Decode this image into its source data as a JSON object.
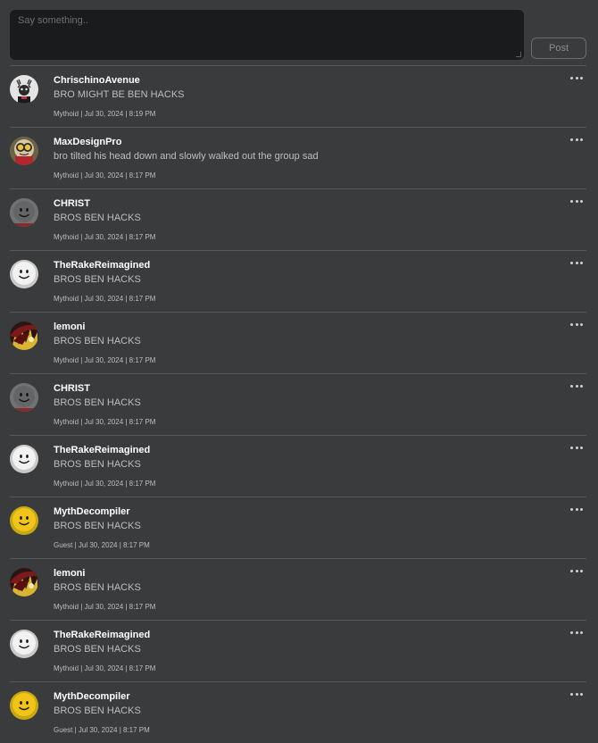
{
  "composer": {
    "placeholder": "Say something..",
    "post_label": "Post"
  },
  "comments": [
    {
      "author": "ChrischinoAvenue",
      "text": "BRO MIGHT BE BEN HACKS",
      "role": "Mythoid",
      "timestamp": "Jul 30, 2024 | 8:19 PM",
      "avatar": "antler-avatar"
    },
    {
      "author": "MaxDesignPro",
      "text": "bro tilted his head down and slowly walked out the group sad",
      "role": "Mythoid",
      "timestamp": "Jul 30, 2024 | 8:17 PM",
      "avatar": "goggles-avatar"
    },
    {
      "author": "CHRIST",
      "text": "BROS BEN HACKS",
      "role": "Mythoid",
      "timestamp": "Jul 30, 2024 | 8:17 PM",
      "avatar": "gray-smile-avatar"
    },
    {
      "author": "TheRakeReimagined",
      "text": "BROS BEN HACKS",
      "role": "Mythoid",
      "timestamp": "Jul 30, 2024 | 8:17 PM",
      "avatar": "white-smile-avatar"
    },
    {
      "author": "lemoni",
      "text": "BROS BEN HACKS",
      "role": "Mythoid",
      "timestamp": "Jul 30, 2024 | 8:17 PM",
      "avatar": "red-hair-avatar"
    },
    {
      "author": "CHRIST",
      "text": "BROS BEN HACKS",
      "role": "Mythoid",
      "timestamp": "Jul 30, 2024 | 8:17 PM",
      "avatar": "gray-smile-avatar"
    },
    {
      "author": "TheRakeReimagined",
      "text": "BROS BEN HACKS",
      "role": "Mythoid",
      "timestamp": "Jul 30, 2024 | 8:17 PM",
      "avatar": "white-smile-avatar"
    },
    {
      "author": "MythDecompiler",
      "text": "BROS BEN HACKS",
      "role": "Guest",
      "timestamp": "Jul 30, 2024 | 8:17 PM",
      "avatar": "yellow-smile-avatar"
    },
    {
      "author": "lemoni",
      "text": "BROS BEN HACKS",
      "role": "Mythoid",
      "timestamp": "Jul 30, 2024 | 8:17 PM",
      "avatar": "red-hair-avatar"
    },
    {
      "author": "TheRakeReimagined",
      "text": "BROS BEN HACKS",
      "role": "Mythoid",
      "timestamp": "Jul 30, 2024 | 8:17 PM",
      "avatar": "white-smile-avatar"
    },
    {
      "author": "MythDecompiler",
      "text": "BROS BEN HACKS",
      "role": "Guest",
      "timestamp": "Jul 30, 2024 | 8:17 PM",
      "avatar": "yellow-smile-avatar"
    }
  ],
  "colors": {
    "background": "#393b3d",
    "composer_bg": "#191b1d",
    "divider": "#56585a",
    "author_text": "#ffffff",
    "body_text": "#bdbebe"
  }
}
